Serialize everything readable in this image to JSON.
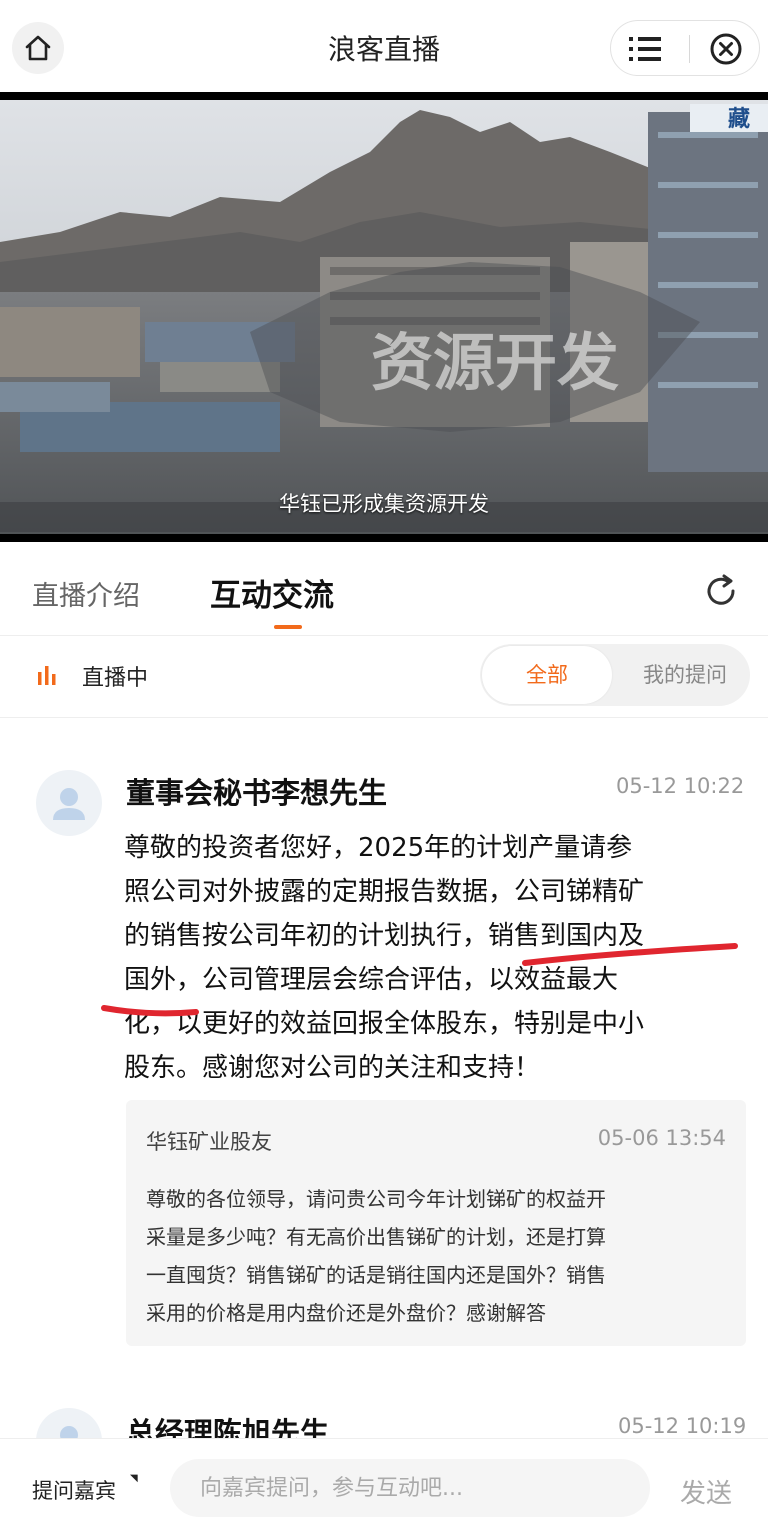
{
  "header": {
    "title": "浪客直播"
  },
  "video": {
    "overlay_text": "资源开发",
    "caption": "华钰已形成集资源开发",
    "logo_text": "藏"
  },
  "tabs": [
    {
      "label": "直播介绍"
    },
    {
      "label": "互动交流"
    }
  ],
  "filter": {
    "status": "直播中",
    "options": [
      "全部",
      "我的提问"
    ],
    "selected": "全部"
  },
  "posts": [
    {
      "author": "董事会秘书李想先生",
      "time": "05-12 10:22",
      "answer_lines": [
        "尊敬的投资者您好，2025年的计划产量请参",
        "照公司对外披露的定期报告数据，公司锑精矿",
        "的销售按公司年初的计划执行，销售到国内及",
        "国外，公司管理层会综合评估，以效益最大",
        "化，以更好的效益回报全体股东，特别是中小",
        "股东。感谢您对公司的关注和支持！"
      ],
      "question": {
        "user": "华钰矿业股友",
        "time": "05-06 13:54",
        "lines": [
          "尊敬的各位领导，请问贵公司今年计划锑矿的权益开",
          "采量是多少吨？有无高价出售锑矿的计划，还是打算",
          "一直囤货？销售锑矿的话是销往国内还是国外？销售",
          "采用的价格是用内盘价还是外盘价？感谢解答"
        ]
      }
    },
    {
      "author": "总经理陈旭先生",
      "time": "05-12 10:19"
    }
  ],
  "bottom": {
    "ask_guest": "提问嘉宾",
    "placeholder": "向嘉宾提问，参与互动吧...",
    "send": "发送"
  },
  "colors": {
    "accent": "#f26a1b",
    "live_bars": "#f26a1b",
    "annotation": "#e0262f"
  }
}
